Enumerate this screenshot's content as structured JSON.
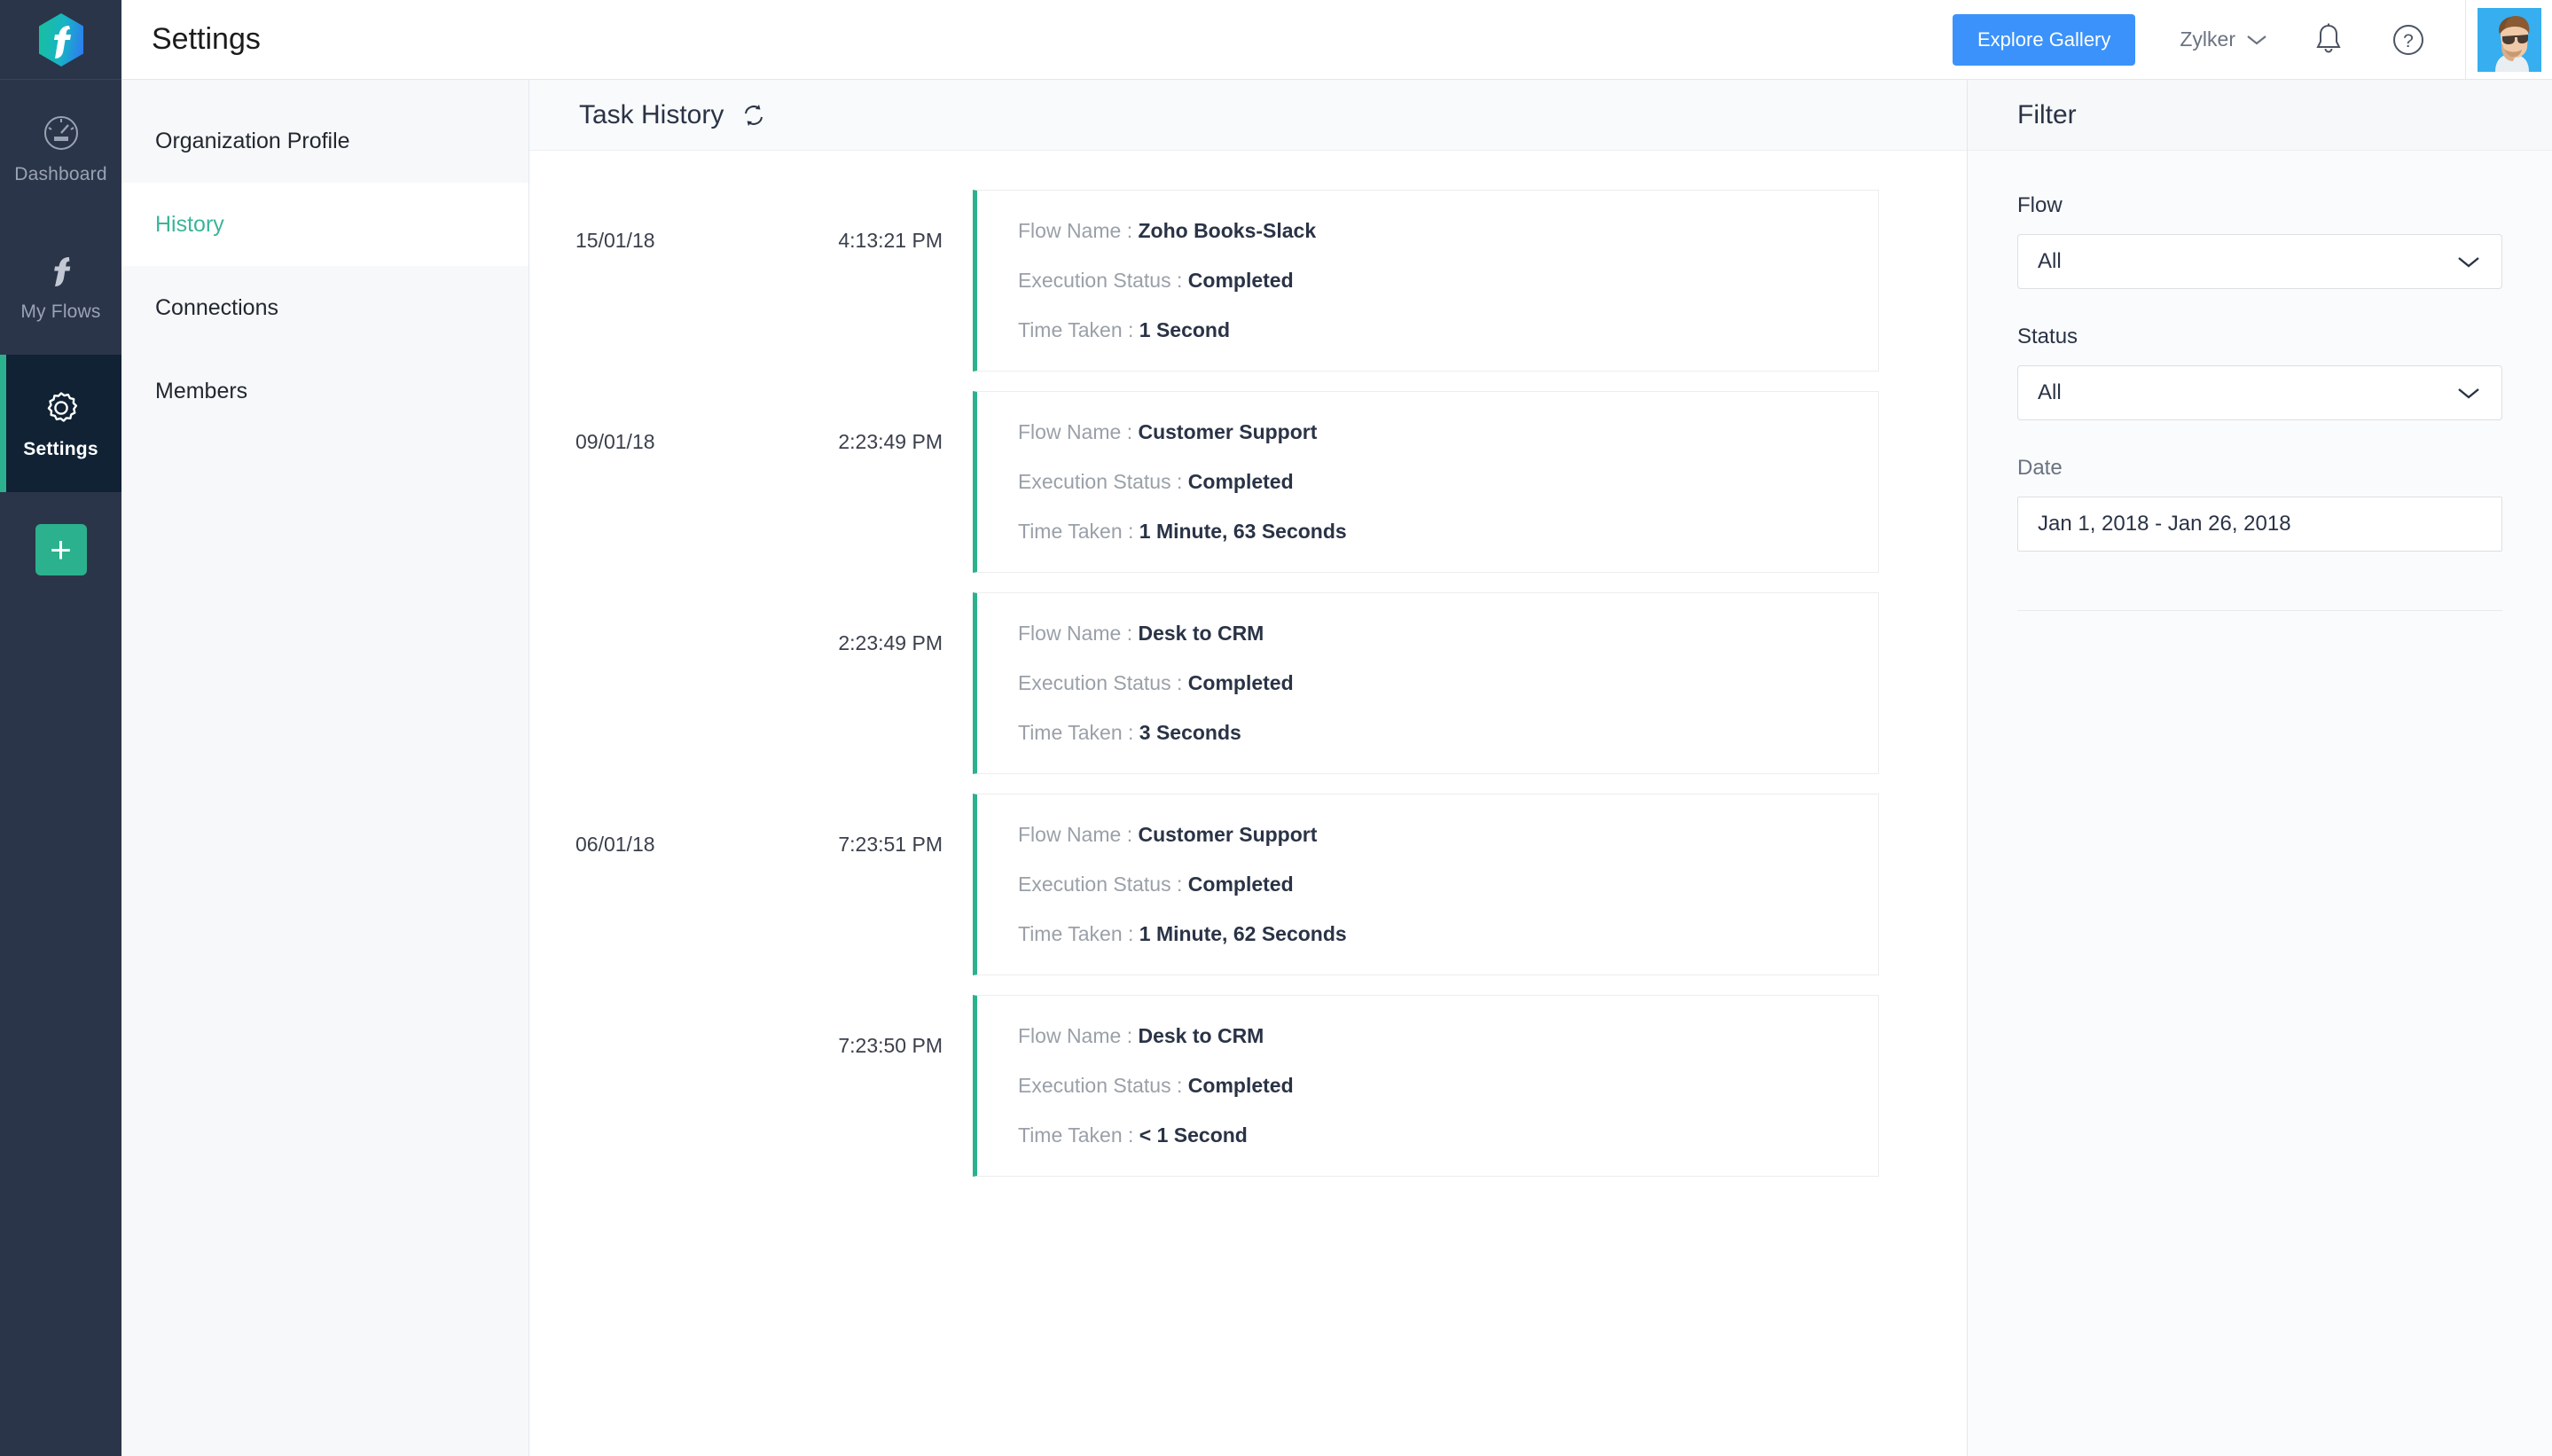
{
  "rail": {
    "logo": "zoho-flow-logo",
    "items": [
      {
        "label": "Dashboard",
        "icon": "gauge-icon",
        "active": false
      },
      {
        "label": "My Flows",
        "icon": "flow-f-icon",
        "active": false
      },
      {
        "label": "Settings",
        "icon": "gear-icon",
        "active": true
      }
    ],
    "add_label": "+"
  },
  "header": {
    "title": "Settings",
    "explore_label": "Explore Gallery",
    "org_name": "Zylker",
    "notifications_icon": "bell-icon",
    "help_icon": "question-circle-icon",
    "avatar_icon": "user-avatar"
  },
  "subnav": {
    "items": [
      {
        "label": "Organization Profile",
        "active": false
      },
      {
        "label": "History",
        "active": true
      },
      {
        "label": "Connections",
        "active": false
      },
      {
        "label": "Members",
        "active": false
      }
    ]
  },
  "content": {
    "title": "Task History",
    "refresh_icon": "refresh-icon",
    "labels": {
      "flow_name": "Flow Name :",
      "execution_status": "Execution Status :",
      "time_taken": "Time Taken :"
    },
    "entries": [
      {
        "date": "15/01/18",
        "time": "4:13:21 PM",
        "flow_name": "Zoho Books-Slack",
        "execution_status": "Completed",
        "time_taken": "1 Second"
      },
      {
        "date": "09/01/18",
        "time": "2:23:49 PM",
        "flow_name": "Customer Support",
        "execution_status": "Completed",
        "time_taken": "1 Minute, 63 Seconds"
      },
      {
        "date": "",
        "time": "2:23:49 PM",
        "flow_name": "Desk to CRM",
        "execution_status": "Completed",
        "time_taken": "3 Seconds"
      },
      {
        "date": "06/01/18",
        "time": "7:23:51 PM",
        "flow_name": "Customer Support",
        "execution_status": "Completed",
        "time_taken": "1 Minute, 62 Seconds"
      },
      {
        "date": "",
        "time": "7:23:50 PM",
        "flow_name": "Desk to CRM",
        "execution_status": "Completed",
        "time_taken": "< 1 Second"
      }
    ]
  },
  "filter": {
    "title": "Filter",
    "flow_label": "Flow",
    "flow_value": "All",
    "status_label": "Status",
    "status_value": "All",
    "date_label": "Date",
    "date_value": "Jan 1, 2018 - Jan 26, 2018"
  },
  "colors": {
    "accent_green": "#2bb18d",
    "accent_blue": "#3b92fb",
    "rail_bg": "#2b3549",
    "rail_active_bg": "#102234",
    "active_link": "#3cb49a"
  }
}
